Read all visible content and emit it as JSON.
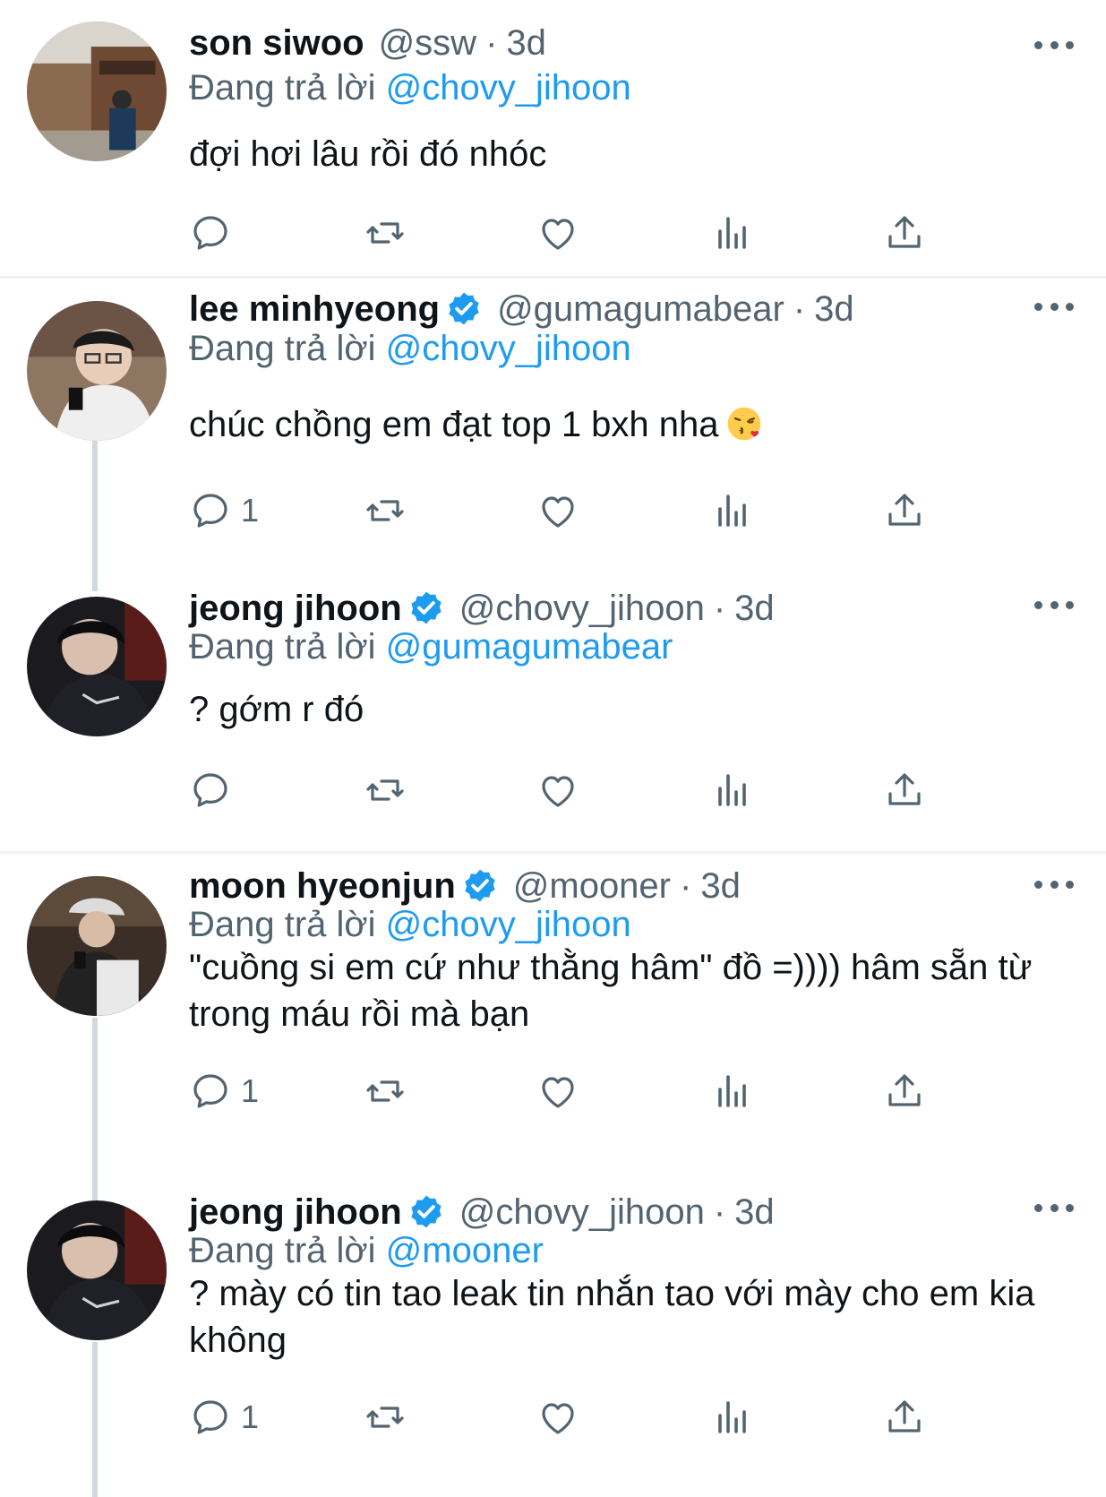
{
  "colors": {
    "accent": "#1d9bf0",
    "muted": "#536471",
    "text": "#0f1419"
  },
  "tweets": [
    {
      "name": "son siwoo",
      "verified": false,
      "handle": "@ssw",
      "dot": "·",
      "time": "3d",
      "reply_prefix": "Đang trả lời",
      "reply_to": "@chovy_jihoon",
      "text": "đợi hơi lâu rồi đó nhóc",
      "reply_count": "",
      "avatar": "photo-street"
    },
    {
      "name": "lee minhyeong",
      "verified": true,
      "handle": "@gumagumabear",
      "dot": "·",
      "time": "3d",
      "reply_prefix": "Đang trả lời",
      "reply_to": "@chovy_jihoon",
      "text": "chúc chồng em đạt top 1 bxh nha",
      "emoji": "kissing-heart-emoji",
      "reply_count": "1",
      "avatar": "photo-glasses"
    },
    {
      "name": "jeong jihoon",
      "verified": true,
      "handle": "@chovy_jihoon",
      "dot": "·",
      "time": "3d",
      "reply_prefix": "Đang trả lời",
      "reply_to": "@gumagumabear",
      "text": "? gớm r đó",
      "reply_count": "",
      "avatar": "photo-dark"
    },
    {
      "name": "moon hyeonjun",
      "verified": true,
      "handle": "@mooner",
      "dot": "·",
      "time": "3d",
      "reply_prefix": "Đang trả lời",
      "reply_to": "@chovy_jihoon",
      "text": "\"cuồng si em cứ như thằng hâm\" đồ =)))) hâm sẵn từ trong máu rồi mà bạn",
      "reply_count": "1",
      "avatar": "photo-cap"
    },
    {
      "name": "jeong jihoon",
      "verified": true,
      "handle": "@chovy_jihoon",
      "dot": "·",
      "time": "3d",
      "reply_prefix": "Đang trả lời",
      "reply_to": "@mooner",
      "text": "? mày có tin tao leak tin nhắn tao với mày cho em kia không",
      "reply_count": "1",
      "avatar": "photo-dark"
    }
  ]
}
